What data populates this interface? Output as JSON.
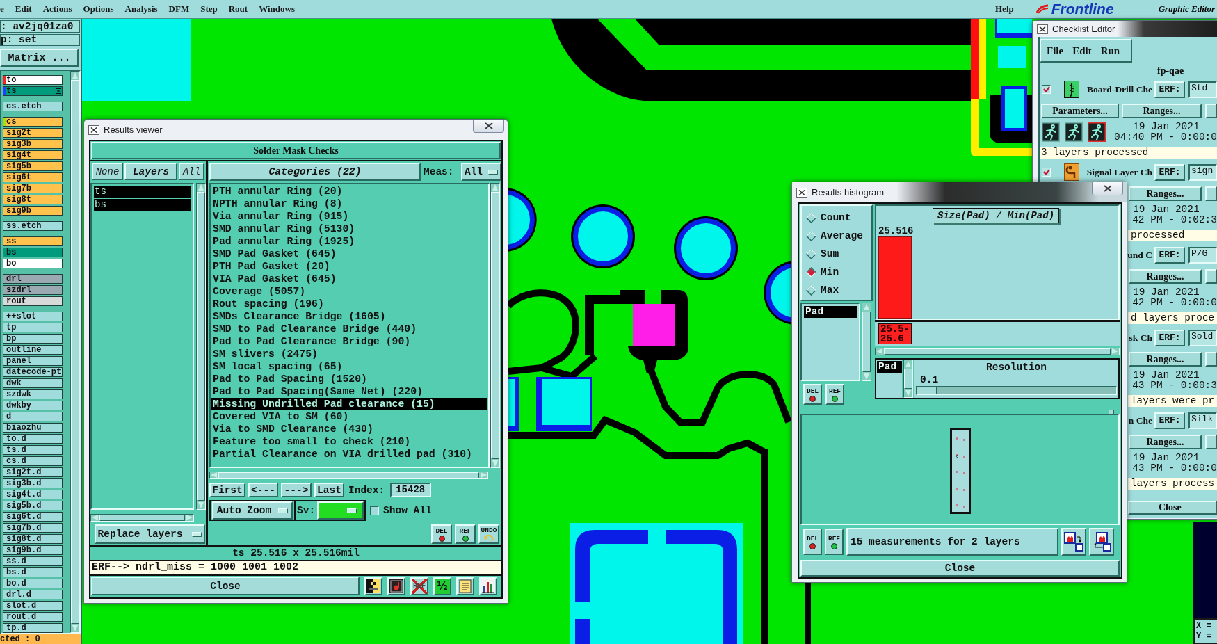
{
  "menu_bar": {
    "items": [
      "e",
      "Edit",
      "Actions",
      "Options",
      "Analysis",
      "DFM",
      "Step",
      "Rout",
      "Windows"
    ],
    "help": "Help",
    "logo": "Frontline",
    "subtitle": "Graphic Editor"
  },
  "sidebar": {
    "job": ": av2jq01za0",
    "step": "p: set",
    "matrix_button": "Matrix ...",
    "layer_groups": [
      [
        {
          "name": "to",
          "color": "#ffffff",
          "marker": {
            "color": "#ff2020"
          },
          "flagged": false
        },
        {
          "name": "ts",
          "color": "#009b7d",
          "marker": {
            "color": "#2040ff"
          },
          "flagged": true
        }
      ],
      [
        {
          "name": "cs.etch",
          "color": "#a0dcdc",
          "flagged": false
        }
      ],
      [
        {
          "name": "cs",
          "color": "#ffc34d",
          "marker": {
            "color": "#a8e000"
          },
          "flagged": false
        },
        {
          "name": "sig2t",
          "color": "#ffc34d",
          "flagged": false
        },
        {
          "name": "sig3b",
          "color": "#ffc34d",
          "flagged": false
        },
        {
          "name": "sig4t",
          "color": "#ffc34d",
          "flagged": false
        },
        {
          "name": "sig5b",
          "color": "#ffc34d",
          "flagged": false
        },
        {
          "name": "sig6t",
          "color": "#ffc34d",
          "flagged": false
        },
        {
          "name": "sig7b",
          "color": "#ffc34d",
          "flagged": false
        },
        {
          "name": "sig8t",
          "color": "#ffc34d",
          "flagged": false
        },
        {
          "name": "sig9b",
          "color": "#ffc34d",
          "flagged": false
        }
      ],
      [
        {
          "name": "ss.etch",
          "color": "#a0dcdc",
          "flagged": false
        }
      ],
      [
        {
          "name": "ss",
          "color": "#ffc34d",
          "flagged": false
        },
        {
          "name": "bs",
          "color": "#009b7d",
          "flagged": false
        },
        {
          "name": "bo",
          "color": "#ffffff",
          "flagged": false
        }
      ],
      [
        {
          "name": "drl",
          "color": "#9aa9b2",
          "flagged": false
        },
        {
          "name": "szdrl",
          "color": "#9aa9b2",
          "flagged": false
        },
        {
          "name": "rout",
          "color": "#d9d9d9",
          "flagged": false
        }
      ],
      [
        {
          "name": "++slot",
          "color": "#a0dcdc",
          "flagged": false
        },
        {
          "name": "tp",
          "color": "#a0dcdc",
          "flagged": false
        },
        {
          "name": "bp",
          "color": "#a0dcdc",
          "flagged": false
        },
        {
          "name": "outline",
          "color": "#a0dcdc",
          "flagged": false
        },
        {
          "name": "panel",
          "color": "#a0dcdc",
          "flagged": false
        },
        {
          "name": "datecode-pt",
          "color": "#a0dcdc",
          "flagged": false
        },
        {
          "name": "dwk",
          "color": "#a0dcdc",
          "flagged": false
        },
        {
          "name": "szdwk",
          "color": "#a0dcdc",
          "flagged": false
        },
        {
          "name": "dwkby",
          "color": "#a0dcdc",
          "flagged": false
        },
        {
          "name": "d",
          "color": "#a0dcdc",
          "flagged": false
        },
        {
          "name": "biaozhu",
          "color": "#a0dcdc",
          "flagged": false
        },
        {
          "name": "to.d",
          "color": "#a0dcdc",
          "flagged": false
        },
        {
          "name": "ts.d",
          "color": "#a0dcdc",
          "flagged": false
        },
        {
          "name": "cs.d",
          "color": "#a0dcdc",
          "flagged": false
        },
        {
          "name": "sig2t.d",
          "color": "#a0dcdc",
          "flagged": false
        },
        {
          "name": "sig3b.d",
          "color": "#a0dcdc",
          "flagged": false
        },
        {
          "name": "sig4t.d",
          "color": "#a0dcdc",
          "flagged": false
        },
        {
          "name": "sig5b.d",
          "color": "#a0dcdc",
          "flagged": false
        },
        {
          "name": "sig6t.d",
          "color": "#a0dcdc",
          "flagged": false
        },
        {
          "name": "sig7b.d",
          "color": "#a0dcdc",
          "flagged": false
        },
        {
          "name": "sig8t.d",
          "color": "#a0dcdc",
          "flagged": false
        },
        {
          "name": "sig9b.d",
          "color": "#a0dcdc",
          "flagged": false
        },
        {
          "name": "ss.d",
          "color": "#a0dcdc",
          "flagged": false
        },
        {
          "name": "bs.d",
          "color": "#a0dcdc",
          "flagged": false
        },
        {
          "name": "bo.d",
          "color": "#a0dcdc",
          "flagged": false
        },
        {
          "name": "drl.d",
          "color": "#a0dcdc",
          "flagged": false
        },
        {
          "name": "slot.d",
          "color": "#a0dcdc",
          "flagged": false
        },
        {
          "name": "rout.d",
          "color": "#a0dcdc",
          "flagged": false
        },
        {
          "name": "tp.d",
          "color": "#a0dcdc",
          "flagged": false
        }
      ]
    ],
    "status": "cted : 0"
  },
  "results_viewer": {
    "title": "Results viewer",
    "heading": "Solder Mask Checks",
    "select_none": "None",
    "layers_header": "Layers",
    "select_all": "All",
    "layers": [
      {
        "name": "ts",
        "selected": true
      },
      {
        "name": "bs",
        "selected": true
      }
    ],
    "replace_menu": "Replace layers",
    "categories_header": "Categories (22)",
    "meas_label": "Meas:",
    "meas_menu": "All",
    "categories": [
      {
        "label": "PTH annular Ring (20)",
        "selected": false
      },
      {
        "label": "NPTH annular Ring (8)",
        "selected": false
      },
      {
        "label": "Via annular Ring (915)",
        "selected": false
      },
      {
        "label": "SMD annular Ring (5130)",
        "selected": false
      },
      {
        "label": "Pad annular Ring (1925)",
        "selected": false
      },
      {
        "label": "SMD Pad Gasket (645)",
        "selected": false
      },
      {
        "label": "PTH Pad Gasket (20)",
        "selected": false
      },
      {
        "label": "VIA Pad Gasket (645)",
        "selected": false
      },
      {
        "label": "Coverage (5057)",
        "selected": false
      },
      {
        "label": "Rout spacing (196)",
        "selected": false
      },
      {
        "label": "SMDs Clearance Bridge (1605)",
        "selected": false
      },
      {
        "label": "SMD to Pad Clearance Bridge (440)",
        "selected": false
      },
      {
        "label": "Pad to Pad Clearance Bridge (90)",
        "selected": false
      },
      {
        "label": "SM slivers (2475)",
        "selected": false
      },
      {
        "label": "SM local spacing (65)",
        "selected": false
      },
      {
        "label": "Pad to Pad Spacing (1520)",
        "selected": false
      },
      {
        "label": "Pad to Pad Spacing(Same Net) (220)",
        "selected": false
      },
      {
        "label": "Missing Undrilled Pad clearance (15)",
        "selected": true
      },
      {
        "label": "Covered VIA to SM (60)",
        "selected": false
      },
      {
        "label": "Via to SMD Clearance (430)",
        "selected": false
      },
      {
        "label": "Feature too small to check (210)",
        "selected": false
      },
      {
        "label": "Partial Clearance on VIA drilled pad (310)",
        "selected": false
      }
    ],
    "nav_buttons": [
      "First",
      "<---",
      "--->",
      "Last"
    ],
    "index_label": "Index:",
    "index_value": "15428",
    "zoom_menu": "Auto Zoom",
    "sv_label": "Sv:",
    "show_all": {
      "label": "Show All",
      "checked": false
    },
    "tool_buttons": [
      {
        "kind": "delete",
        "label": "DEL"
      },
      {
        "kind": "reference",
        "label": "REF"
      },
      {
        "kind": "undo",
        "label": "UNDO"
      }
    ],
    "measurement": "ts 25.516 x 25.516mil",
    "erf_line": "ERF--> ndrl_miss = 1000 1001 1002",
    "close": "Close",
    "tool_icons": [
      {
        "kind": "contrast"
      },
      {
        "kind": "picture"
      },
      {
        "kind": "ref_off",
        "label": "REF"
      },
      {
        "kind": "ratio",
        "label": "½"
      },
      {
        "kind": "notes"
      },
      {
        "kind": "chart"
      }
    ]
  },
  "results_histogram": {
    "title": "Results histogram",
    "modes": [
      {
        "label": "Count",
        "selected": false
      },
      {
        "label": "Average",
        "selected": false
      },
      {
        "label": "Sum",
        "selected": false
      },
      {
        "label": "Min",
        "selected": true
      },
      {
        "label": "Max",
        "selected": false
      }
    ],
    "features": [
      {
        "name": "Pad",
        "selected": true
      }
    ],
    "list_buttons": [
      {
        "kind": "delete",
        "label": "DEL"
      },
      {
        "kind": "reference",
        "label": "REF"
      }
    ],
    "chart_data": {
      "type": "bar",
      "title": "Size(Pad) / Min(Pad)",
      "categories": [
        "25.5-25.6"
      ],
      "values": [
        25.516
      ],
      "data_labels": true
    },
    "resolution_features": [
      {
        "name": "Pad",
        "selected": true
      }
    ],
    "resolution_label": "Resolution",
    "resolution_value": "0.1",
    "resolution_slider": {
      "level": 0
    },
    "footer_buttons": [
      {
        "kind": "delete",
        "label": "DEL"
      },
      {
        "kind": "reference",
        "label": "REF"
      }
    ],
    "summary": "15 measurements for 2 layers",
    "export_icons": [
      {
        "kind": "to_box"
      },
      {
        "kind": "from_box"
      }
    ],
    "close": "Close"
  },
  "checklist_editor": {
    "title": "Checklist Editor",
    "menu": [
      "File",
      "Edit",
      "Run"
    ],
    "name": "fp-qae",
    "checks": [
      {
        "kind": "full",
        "checked": true,
        "name": "Board-Drill Che",
        "erf_label": "ERF:",
        "erf_value": "Std",
        "parameters": "Parameters...",
        "ranges": "Ranges...",
        "date": "19 Jan 2021",
        "time": "04:40 PM - 0:00:0",
        "status": "3 layers processed"
      },
      {
        "kind": "covered",
        "checked": true,
        "name": "Signal Layer Ch",
        "erf_label": "ERF:",
        "erf_value": "sign",
        "ranges": "Ranges...",
        "date": "19 Jan 2021",
        "time": "42 PM - 0:02:3",
        "status": "processed"
      },
      {
        "kind": "covered",
        "name": "und C",
        "erf_label": "ERF:",
        "erf_value": "P/G",
        "ranges": "Ranges...",
        "date": "19 Jan 2021",
        "time": "42 PM - 0:00:0",
        "status": "d layers proce"
      },
      {
        "kind": "covered",
        "name": "sk Ch",
        "erf_label": "ERF:",
        "erf_value": "Sold",
        "ranges": "Ranges...",
        "date": "19 Jan 2021",
        "time": "43 PM - 0:00:3",
        "status": "layers were pr"
      },
      {
        "kind": "covered",
        "name": "n Che",
        "erf_label": "ERF:",
        "erf_value": "Silk",
        "ranges": "Ranges...",
        "date": "19 Jan 2021",
        "time": "43 PM - 0:00:0",
        "status": "layers process"
      }
    ],
    "close": "Close"
  },
  "coordinates": [
    "X =",
    "Y ="
  ]
}
